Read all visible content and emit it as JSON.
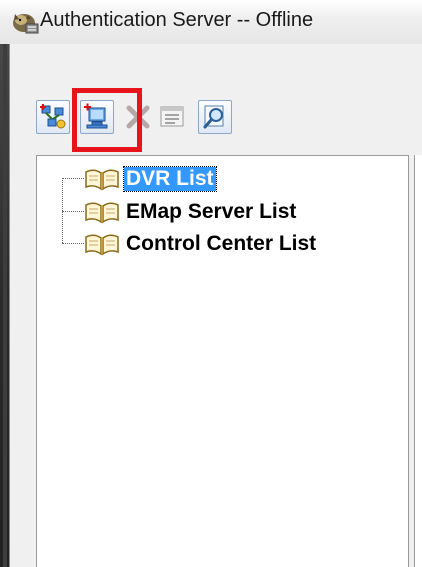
{
  "window": {
    "title": "Authentication Server -- Offline",
    "app_icon": "server-wolf-icon"
  },
  "toolbar": {
    "buttons": [
      {
        "name": "add-group-button",
        "icon": "add-network-group-icon",
        "enabled": true
      },
      {
        "name": "add-item-button",
        "icon": "add-computer-icon",
        "enabled": true,
        "highlighted": true
      },
      {
        "name": "delete-button",
        "icon": "delete-x-icon",
        "enabled": false
      },
      {
        "name": "properties-button",
        "icon": "properties-list-icon",
        "enabled": false
      },
      {
        "name": "search-button",
        "icon": "magnifier-icon",
        "enabled": true
      }
    ],
    "highlight_color": "#e8141c"
  },
  "tree": {
    "items": [
      {
        "label": "DVR List",
        "icon": "open-book-icon",
        "selected": true
      },
      {
        "label": "EMap Server List",
        "icon": "open-book-icon",
        "selected": false
      },
      {
        "label": "Control Center List",
        "icon": "open-book-icon",
        "selected": false
      }
    ],
    "selection_color": "#3399ff"
  }
}
